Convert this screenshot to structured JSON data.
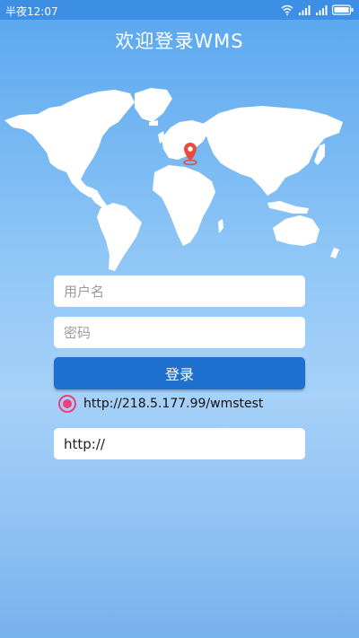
{
  "status_bar": {
    "time": "半夜12:07",
    "icons": [
      "wifi-icon",
      "signal-icon",
      "signal-icon",
      "battery-icon"
    ]
  },
  "app": {
    "title": "欢迎登录WMS"
  },
  "map": {
    "land_color": "#ffffff",
    "marker_color": "#e74c3c",
    "icons": [
      "location-pin-icon"
    ]
  },
  "form": {
    "username_placeholder": "用户名",
    "username_value": "",
    "password_placeholder": "密码",
    "password_value": "",
    "login_label": "登录",
    "server_option_label": "http://218.5.177.99/wmstest",
    "server_option_selected": true,
    "server_url_value": "http://",
    "server_url_placeholder": ""
  },
  "colors": {
    "status_bar": "#3d8fe5",
    "button": "#1f6fcf",
    "radio_accent": "#ec407a"
  }
}
